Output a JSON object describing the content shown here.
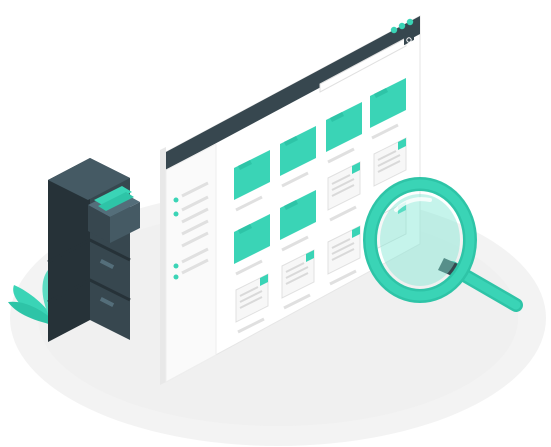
{
  "colors": {
    "accent": "#3ad4b6",
    "accent_light": "#7fe6d2",
    "dark": "#37474f",
    "dark_mid": "#455a64",
    "ground": "#f5f5f5",
    "window_bg": "#ffffff",
    "panel_bg": "#fafafa",
    "line": "#e0e0e0",
    "line_dark": "#cfcfcf"
  },
  "icons": {
    "window_control_icon": "search-icon",
    "tool": "magnifying-glass",
    "storage": "filing-cabinet",
    "decor": "plant-leaves"
  },
  "window": {
    "control_dots": 3,
    "folder_count": 6,
    "document_count": 6
  }
}
